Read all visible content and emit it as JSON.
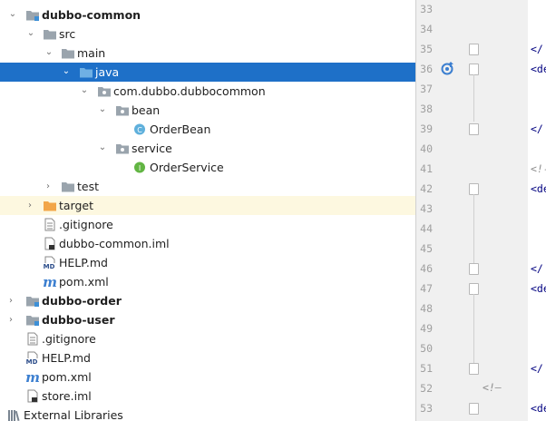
{
  "project_tree": {
    "rows": [
      {
        "label": "dubbo-common",
        "icon": "module-folder",
        "bold": true
      },
      {
        "label": "src",
        "icon": "folder"
      },
      {
        "label": "main",
        "icon": "folder"
      },
      {
        "label": "java",
        "icon": "source-folder",
        "selected": true
      },
      {
        "label": "com.dubbo.dubbocommon",
        "icon": "package"
      },
      {
        "label": "bean",
        "icon": "package"
      },
      {
        "label": "OrderBean",
        "icon": "class-c"
      },
      {
        "label": "service",
        "icon": "package"
      },
      {
        "label": "OrderService",
        "icon": "interface-i"
      },
      {
        "label": "test",
        "icon": "folder"
      },
      {
        "label": "target",
        "icon": "excluded-folder"
      },
      {
        "label": ".gitignore",
        "icon": "text-file"
      },
      {
        "label": "dubbo-common.iml",
        "icon": "iml-file"
      },
      {
        "label": "HELP.md",
        "icon": "md-file"
      },
      {
        "label": "pom.xml",
        "icon": "maven-file"
      },
      {
        "label": "dubbo-order",
        "icon": "module-folder",
        "bold": true
      },
      {
        "label": "dubbo-user",
        "icon": "module-folder",
        "bold": true
      },
      {
        "label": ".gitignore",
        "icon": "text-file"
      },
      {
        "label": "HELP.md",
        "icon": "md-file"
      },
      {
        "label": "pom.xml",
        "icon": "maven-file"
      },
      {
        "label": "store.iml",
        "icon": "iml-file"
      },
      {
        "label": "External Libraries",
        "icon": "libraries"
      }
    ],
    "badges": {
      "md": "MD",
      "class": "C",
      "interface": "I",
      "maven": "m"
    }
  },
  "editor": {
    "line_numbers": [
      "33",
      "34",
      "35",
      "36",
      "37",
      "38",
      "39",
      "40",
      "41",
      "42",
      "43",
      "44",
      "45",
      "46",
      "47",
      "48",
      "49",
      "50",
      "51",
      "52",
      "53"
    ],
    "code_fragments": [
      "</",
      "<de",
      "</",
      "<!-",
      "<de",
      "</",
      "<de",
      "</",
      "<!—",
      "<de"
    ],
    "gutter_icon": "override-method-icon",
    "current_line": "52"
  },
  "colors": {
    "selection": "#1e70c8",
    "current_line_bg": "#fdf8e0",
    "gutter_bg": "#f0f0f0",
    "tag_color": "#000080"
  }
}
